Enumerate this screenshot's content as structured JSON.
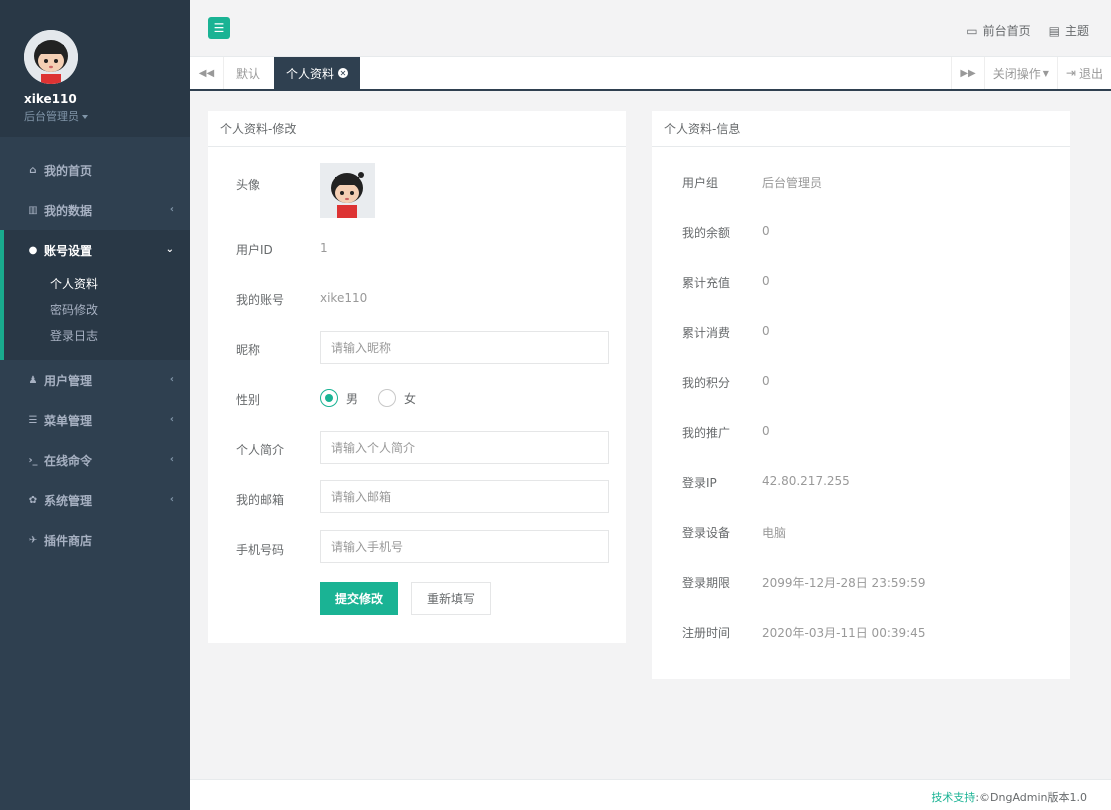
{
  "user": {
    "name": "xike110",
    "role": "后台管理员"
  },
  "nav": {
    "home": "我的首页",
    "data": "我的数据",
    "account": "账号设置",
    "account_sub": [
      "个人资料",
      "密码修改",
      "登录日志"
    ],
    "users": "用户管理",
    "menu": "菜单管理",
    "console": "在线命令",
    "system": "系统管理",
    "plugins": "插件商店"
  },
  "top": {
    "front_home": "前台首页",
    "theme": "主题"
  },
  "tabs": {
    "default": "默认",
    "current": "个人资料",
    "close_ops": "关闭操作",
    "logout": "退出"
  },
  "form": {
    "title": "个人资料-修改",
    "avatar_label": "头像",
    "userid_label": "用户ID",
    "userid_value": "1",
    "account_label": "我的账号",
    "account_value": "xike110",
    "nickname_label": "昵称",
    "nickname_placeholder": "请输入昵称",
    "gender_label": "性别",
    "gender_male": "男",
    "gender_female": "女",
    "bio_label": "个人简介",
    "bio_placeholder": "请输入个人简介",
    "email_label": "我的邮箱",
    "email_placeholder": "请输入邮箱",
    "phone_label": "手机号码",
    "phone_placeholder": "请输入手机号",
    "submit": "提交修改",
    "reset": "重新填写"
  },
  "info": {
    "title": "个人资料-信息",
    "rows": [
      {
        "label": "用户组",
        "value": "后台管理员"
      },
      {
        "label": "我的余额",
        "value": "0"
      },
      {
        "label": "累计充值",
        "value": "0"
      },
      {
        "label": "累计消费",
        "value": "0"
      },
      {
        "label": "我的积分",
        "value": "0"
      },
      {
        "label": "我的推广",
        "value": "0"
      },
      {
        "label": "登录IP",
        "value": "42.80.217.255"
      },
      {
        "label": "登录设备",
        "value": "电脑"
      },
      {
        "label": "登录期限",
        "value": "2099年-12月-28日 23:59:59"
      },
      {
        "label": "注册时间",
        "value": "2020年-03月-11日 00:39:45"
      }
    ]
  },
  "footer": {
    "link": "技术支持",
    "text": ":©DngAdmin版本1.0"
  },
  "colors": {
    "sidebar": "#2f4050",
    "accent": "#1ab394"
  }
}
